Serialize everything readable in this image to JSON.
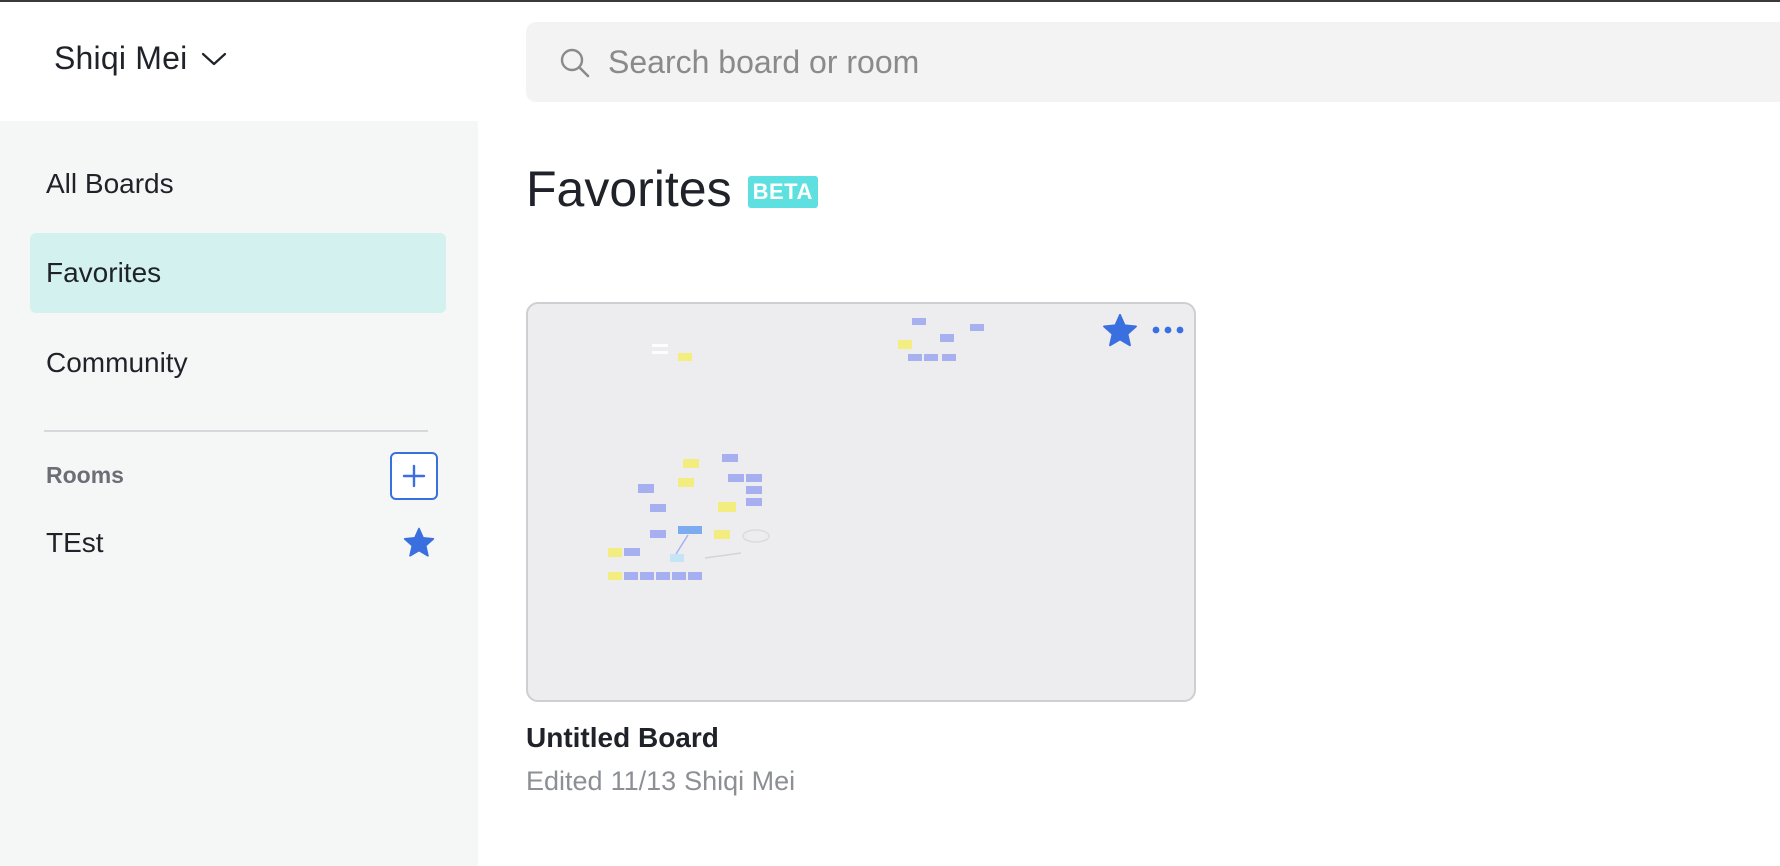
{
  "header": {
    "workspace_name": "Shiqi Mei",
    "search_placeholder": "Search board or room"
  },
  "sidebar": {
    "items": [
      {
        "label": "All Boards",
        "active": false
      },
      {
        "label": "Favorites",
        "active": true
      },
      {
        "label": "Community",
        "active": false
      }
    ],
    "rooms_label": "Rooms",
    "rooms": [
      {
        "name": "TEst",
        "favorited": true
      }
    ]
  },
  "main": {
    "title": "Favorites",
    "badge": "BETA",
    "boards": [
      {
        "title": "Untitled Board",
        "edited_label": "Edited",
        "edited_date": "11/13",
        "edited_by": "Shiqi Mei",
        "favorited": true
      }
    ]
  },
  "colors": {
    "accent_blue": "#3a6fe0",
    "active_item_bg": "#d3f1ef",
    "beta_badge": "#5fe0e0",
    "sidebar_bg": "#f5f7f6",
    "search_bg": "#f3f3f3"
  },
  "icons": {
    "workspace_dropdown": "chevron-down-icon",
    "search": "search-icon",
    "add_room": "plus-icon",
    "favorite": "star-icon",
    "more": "more-horizontal-icon"
  }
}
